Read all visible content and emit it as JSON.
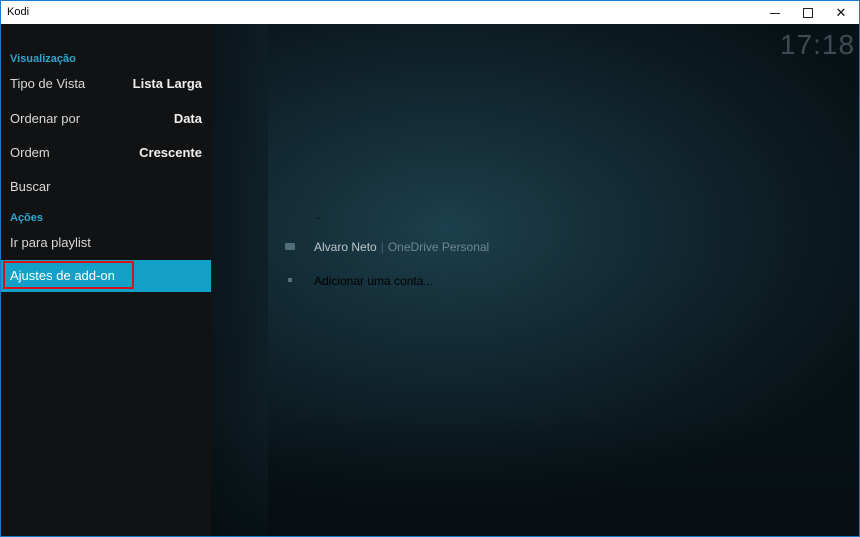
{
  "window": {
    "title": "Kodi",
    "minimize_glyph": "minimize-icon",
    "maximize_glyph": "maximize-icon",
    "close_glyph": "✕"
  },
  "clock": "17:18",
  "sidebar": {
    "section_view": "Visualização",
    "options": [
      {
        "label": "Tipo de Vista",
        "value": "Lista Larga"
      },
      {
        "label": "Ordenar por",
        "value": "Data"
      },
      {
        "label": "Ordem",
        "value": "Crescente"
      },
      {
        "label": "Buscar",
        "value": ""
      }
    ],
    "section_actions": "Ações",
    "actions": [
      {
        "label": "Ir para playlist"
      },
      {
        "label": "Ajustes de add-on",
        "selected": true
      }
    ]
  },
  "file_list": {
    "parent": "..",
    "items": [
      {
        "title": "Alvaro Neto",
        "separator": "|",
        "subtitle": "OneDrive Personal",
        "icon": "folder-icon"
      },
      {
        "title": "Adicionar uma conta...",
        "icon": "add-icon"
      }
    ]
  },
  "colors": {
    "accent": "#12a0c9",
    "section_header": "#2fa5d2",
    "highlight_border": "#d6131b"
  }
}
